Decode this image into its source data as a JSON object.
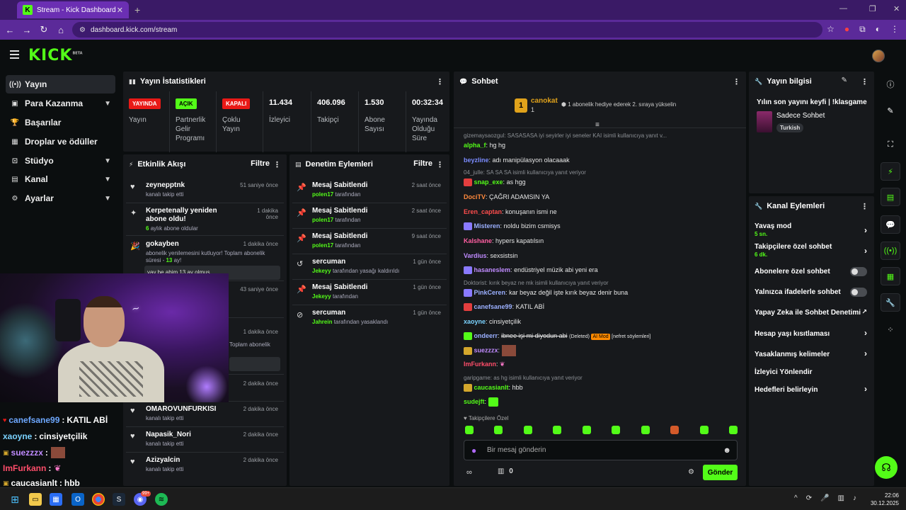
{
  "browser": {
    "tab_title": "Stream - Kick Dashboard",
    "url": "dashboard.kick.com/stream"
  },
  "header": {
    "logo": "KICK",
    "beta": "BETA"
  },
  "sidebar": {
    "items": [
      {
        "label": "Yayın",
        "icon": "stream-icon"
      },
      {
        "label": "Para Kazanma",
        "icon": "money-icon"
      },
      {
        "label": "Başarılar",
        "icon": "trophy-icon"
      },
      {
        "label": "Droplar ve ödüller",
        "icon": "gift-icon"
      },
      {
        "label": "Stüdyo",
        "icon": "studio-icon"
      },
      {
        "label": "Kanal",
        "icon": "channel-icon"
      },
      {
        "label": "Ayarlar",
        "icon": "gear-icon"
      }
    ]
  },
  "stats": {
    "title": "Yayın İstatistikleri",
    "items": [
      {
        "badge": "YAYINDA",
        "label": "Yayın"
      },
      {
        "badge": "AÇIK",
        "label": "Partnerlik Gelir Programı"
      },
      {
        "badge": "KAPALI",
        "label": "Çoklu Yayın"
      },
      {
        "value": "11.434",
        "label": "İzleyici"
      },
      {
        "value": "406.096",
        "label": "Takipçi"
      },
      {
        "value": "1.530",
        "label": "Abone Sayısı"
      },
      {
        "value": "00:32:34",
        "label": "Yayında Olduğu Süre"
      }
    ]
  },
  "activity": {
    "title": "Etkinlik Akışı",
    "filter": "Filtre",
    "rows": [
      {
        "title": "zeynepptnk",
        "sub": "kanalı takip etti",
        "time": "51 saniye önce"
      },
      {
        "title": "Kerpetenally yeniden abone oldu!",
        "sub_num": "6",
        "sub": "aylık abone oldular",
        "time": "1 dakika önce"
      },
      {
        "title": "gokayben",
        "sub": "abonelik yenilemesini kutluyor! Toplam abonelik süresi -",
        "sub_num": "13",
        "sub2": "ay!",
        "time": "1 dakika önce"
      },
      {
        "title": "",
        "sub": "",
        "time": "43 saniye önce"
      },
      {
        "title": "",
        "sub": "Toplam abonelik",
        "time": "1 dakika önce"
      },
      {
        "title": "",
        "sub": "",
        "time": "2 dakika önce"
      },
      {
        "title": "OMAROVUNFURKISI",
        "sub": "kanalı takip etti",
        "time": "2 dakika önce"
      },
      {
        "title": "Napasik_Nori",
        "sub": "kanalı takip etti",
        "time": "2 dakika önce"
      },
      {
        "title": "Azizyalcin",
        "sub": "kanalı takip etti",
        "time": "2 dakika önce"
      }
    ],
    "gok_msg": "yay be abim 13 ay olmus"
  },
  "mod": {
    "title": "Denetim Eylemleri",
    "filter": "Filtre",
    "rows": [
      {
        "title": "Mesaj Sabitlendi",
        "user": "polen17",
        "sub": "tarafından",
        "time": "2 saat önce",
        "icon": "pin-icon"
      },
      {
        "title": "Mesaj Sabitlendi",
        "user": "polen17",
        "sub": "tarafından",
        "time": "2 saat önce",
        "icon": "pin-icon"
      },
      {
        "title": "Mesaj Sabitlendi",
        "user": "polen17",
        "sub": "tarafından",
        "time": "9 saat önce",
        "icon": "pin-icon"
      },
      {
        "title": "sercuman",
        "user": "Jekeyy",
        "sub": "tarafından yasağı kaldırıldı",
        "time": "1 gün önce",
        "icon": "undo-icon"
      },
      {
        "title": "Mesaj Sabitlendi",
        "user": "Jekeyy",
        "sub": "tarafından",
        "time": "1 gün önce",
        "icon": "pin-icon"
      },
      {
        "title": "sercuman",
        "user": "Jahrein",
        "sub": "tarafından yasaklandı",
        "time": "1 gün önce",
        "icon": "ban-icon"
      }
    ]
  },
  "chat": {
    "title": "Sohbet",
    "top_user": "canokat",
    "top_rank": "1",
    "top_count": "1",
    "top_note": "1 abonelik hediye ederek 2. sıraya yükselin",
    "messages": [
      {
        "type": "reply",
        "text": "gizemaysaozgul: SASASASA iyi seyirler iyi seneler KAI isimli kullanıcıya yanıt v..."
      },
      {
        "user": "alpha_f",
        "color": "#53fc18",
        "text": "hg hg"
      },
      {
        "user": "beyzline",
        "color": "#7b8cff",
        "text": "adı manipülasyon olacaaak"
      },
      {
        "type": "reply",
        "text": "04_julle: SA SA SA isimli kullanıcıya yanıt veriyor"
      },
      {
        "user": "snap_exe",
        "color": "#53fc18",
        "text": "as hgg"
      },
      {
        "user": "DociTV",
        "color": "#ff8a3d",
        "text": "ÇAĞRI ADAMSIN YA"
      },
      {
        "user": "Eren_captan",
        "color": "#ff4d4d",
        "text": "konuşanın ismi ne"
      },
      {
        "user": "Misteren",
        "color": "#9bb0ff",
        "text": "noldu bizim csmisys"
      },
      {
        "user": "Kalshane",
        "color": "#ff5fa2",
        "text": "hypers kapatılsın"
      },
      {
        "user": "Vardius",
        "color": "#c08bff",
        "text": "sexsistsin"
      },
      {
        "user": "hasaneslem",
        "color": "#c08bff",
        "text": "endüstriyel müzik abi yeni era"
      },
      {
        "type": "reply",
        "text": "Doktorist: kırık beyaz ne mk isimli kullanıcıya yanıt veriyor"
      },
      {
        "user": "PinkCeren",
        "color": "#9bb0ff",
        "text": "kar beyaz değil işte kırık beyaz denir buna"
      },
      {
        "user": "canefsane99",
        "color": "#9bb0ff",
        "text": "KATIL ABİ"
      },
      {
        "user": "xaoyne",
        "color": "#7bd3ff",
        "text": "cinsiyetçilik"
      },
      {
        "user": "ondeerr",
        "color": "#9bb0ff",
        "text": "ibnee işi mi diyodun abi",
        "deleted": "(Deleted)",
        "tag": "AI Mod",
        "reason": "[nefret söylemleri]"
      },
      {
        "user": "suezzzx",
        "color": "#c08bff",
        "text": ""
      },
      {
        "user": "ImFurkann",
        "color": "#ff4d6a",
        "text": ""
      },
      {
        "type": "reply",
        "text": "garipgame: as hg isimli kullanıcıya yanıt veriyor"
      },
      {
        "user": "caucasianlt",
        "color": "#53fc18",
        "text": "hbb"
      },
      {
        "user": "sudejft",
        "color": "#53fc18",
        "text": ""
      }
    ],
    "followers_only": "Takipçilere Özel",
    "input_placeholder": "Bir mesaj gönderin",
    "points": "0",
    "send": "Gönder"
  },
  "overlay_chat": [
    {
      "user": "canefsane99",
      "text": "KATIL ABİ",
      "color": "#6ea8ff"
    },
    {
      "user": "xaoyne",
      "text": "cinsiyetçilik",
      "color": "#7bd3ff"
    },
    {
      "user": "suezzzx",
      "text": "",
      "color": "#c08bff"
    },
    {
      "user": "ImFurkann",
      "text": "",
      "color": "#ff4d6a"
    },
    {
      "user": "caucasianlt",
      "text": "hbb",
      "color": "#ffffff"
    }
  ],
  "stream_info": {
    "title": "Yayın bilgisi",
    "stream_title": "Yılın son yayını keyfi | !klasgame",
    "category": "Sadece Sohbet",
    "tag": "Turkish"
  },
  "channel_actions": {
    "title": "Kanal Eylemleri",
    "rows": [
      {
        "label": "Yavaş mod",
        "sub": "5 sn.",
        "control": "chevron"
      },
      {
        "label": "Takipçilere özel sohbet",
        "sub": "6 dk.",
        "control": "chevron"
      },
      {
        "label": "Abonelere özel sohbet",
        "control": "toggle"
      },
      {
        "label": "Yalnızca ifadelerle sohbet",
        "control": "toggle"
      },
      {
        "label": "Yapay Zeka ile Sohbet Denetimi",
        "control": "external"
      },
      {
        "label": "Hesap yaşı kısıtlaması",
        "control": "chevron"
      },
      {
        "label": "Yasaklanmış kelimeler",
        "control": "chevron"
      },
      {
        "label": "İzleyici Yönlendir",
        "control": "none"
      },
      {
        "label": "Hedefleri belirleyin",
        "control": "chevron"
      }
    ]
  },
  "taskbar": {
    "time": "22:06",
    "date": "30.12.2025",
    "badge": "99+"
  },
  "colors": {
    "accent": "#53fc18",
    "live": "#e91916",
    "panel": "#17191c",
    "bg": "#0b0e0f"
  }
}
